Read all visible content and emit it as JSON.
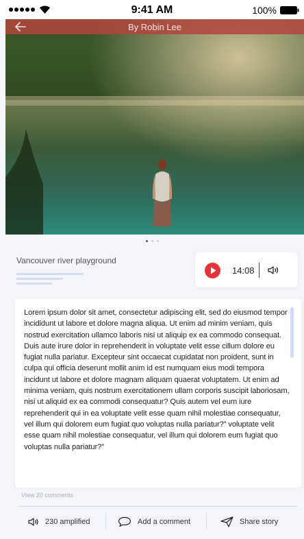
{
  "status_bar": {
    "time": "9:41 AM",
    "battery_percent": "100%",
    "signal_icon": "signal-dots-icon",
    "wifi_icon": "wifi-icon",
    "battery_icon": "battery-icon"
  },
  "header": {
    "author": "By Robin Lee",
    "back_icon": "back-arrow-icon"
  },
  "carousel": {
    "page_count": 3,
    "active_index": 0
  },
  "story": {
    "title": "Vancouver river playground"
  },
  "player": {
    "duration": "14:08",
    "play_icon": "play-icon",
    "volume_icon": "volume-icon"
  },
  "article": {
    "body": "Lorem ipsum dolor sit amet, consectetur adipiscing elit, sed do eiusmod tempor incididunt ut labore et dolore magna aliqua. Ut enim ad minim veniam, quis nostrud exercitation ullamco laboris nisi ut aliquip ex ea commodo consequat. Duis aute irure dolor in reprehenderit in voluptate velit esse cillum dolore eu fugiat nulla pariatur. Excepteur sint occaecat cupidatat non proident, sunt in culpa qui officia deserunt mollit anim id est numquam eius modi tempora incidunt ut labore et dolore magnam aliquam quaerat voluptatem. Ut enim ad minima veniam, quis nostrum exercitationem ullam corporis suscipit laboriosam, nisi ut aliquid ex ea commodi consequatur? Quis autem vel eum iure reprehenderit qui in ea voluptate velit esse quam nihil molestiae consequatur, vel illum qui dolorem eum fugiat quo voluptas nulla pariatur?” voluptate velit esse quam nihil molestiae consequatur, vel illum qui dolorem eum fugiat quo voluptas nulla pariatur?”"
  },
  "comments": {
    "view_label": "View 20 comments"
  },
  "actions": {
    "amplified_label": "230 amplified",
    "add_comment_label": "Add a comment",
    "share_label": "Share story"
  },
  "colors": {
    "accent_red": "#e8323c",
    "header_overlay": "#b2463c",
    "background": "#f4f5f9",
    "divider": "#d3d9ee"
  }
}
